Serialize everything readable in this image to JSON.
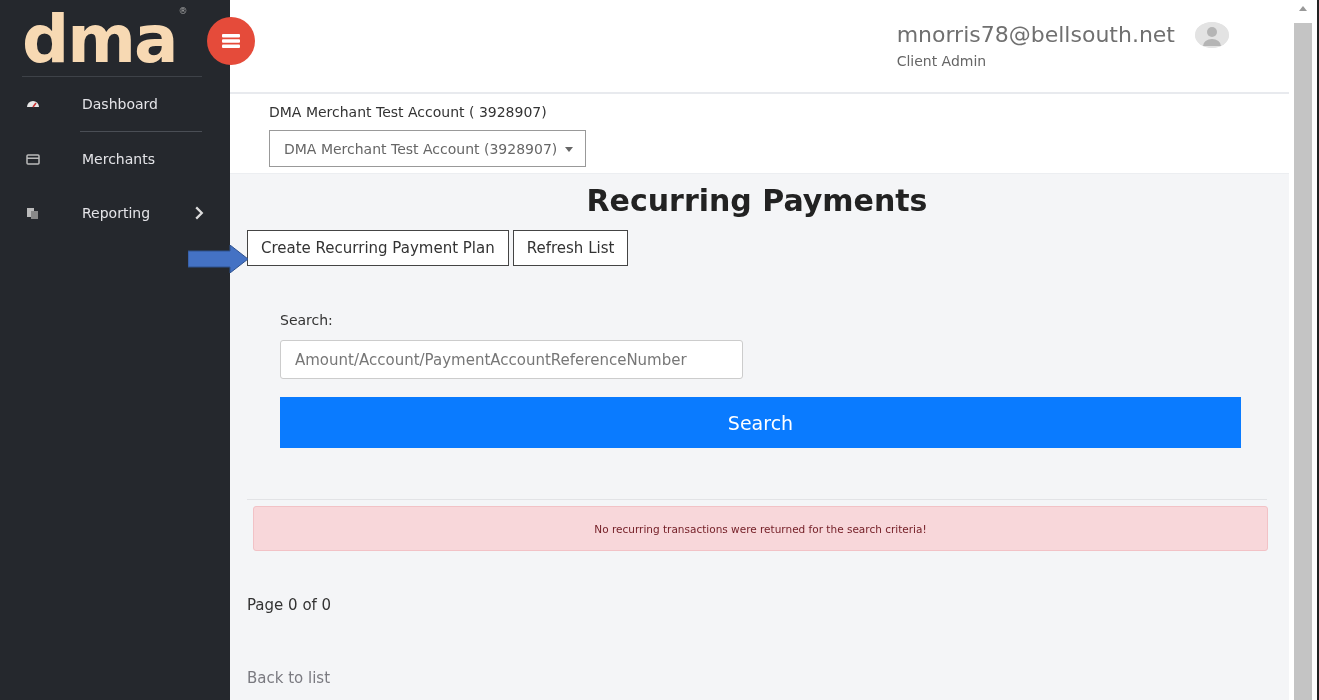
{
  "logo": {
    "text": "dma",
    "mark": "®"
  },
  "sidebar": {
    "items": [
      {
        "label": "Dashboard"
      },
      {
        "label": "Merchants"
      },
      {
        "label": "Reporting"
      }
    ]
  },
  "header": {
    "email": "mnorris78@bellsouth.net",
    "role": "Client Admin"
  },
  "account": {
    "label": "DMA Merchant Test Account ( 3928907)",
    "selected": "DMA Merchant Test Account (3928907)"
  },
  "title": "Recurring Payments",
  "actions": [
    {
      "label": "Create Recurring Payment Plan"
    },
    {
      "label": "Refresh List"
    }
  ],
  "search": {
    "label": "Search:",
    "placeholder": "Amount/Account/PaymentAccountReferenceNumber",
    "button": "Search"
  },
  "alert": "No recurring transactions were returned for the search criteria!",
  "pagination": "Page 0 of 0",
  "back_link": "Back to list"
}
